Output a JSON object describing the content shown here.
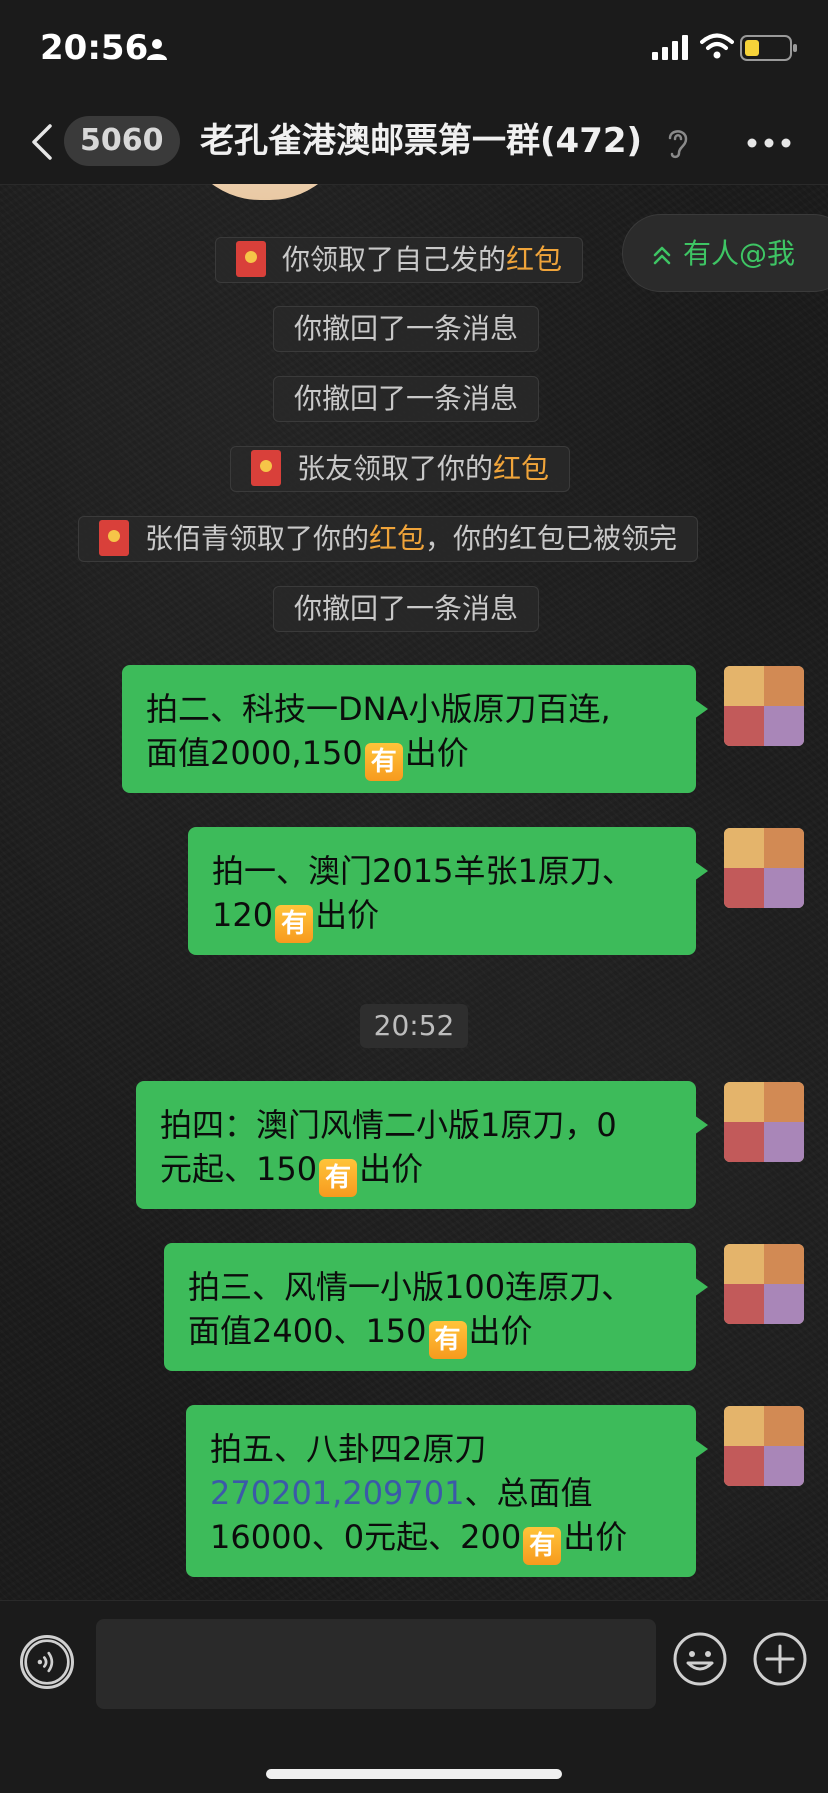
{
  "status_bar": {
    "time": "20:56"
  },
  "nav": {
    "unread_count": "5060",
    "title": "老孔雀港澳邮票第一群(472)"
  },
  "mention_pill": {
    "label": "有人@我"
  },
  "system_notices": [
    {
      "prefix": "你领取了自己发的",
      "highlight": "红包",
      "suffix": ""
    },
    {
      "prefix": "你撤回了一条消息",
      "highlight": "",
      "suffix": ""
    },
    {
      "prefix": "你撤回了一条消息",
      "highlight": "",
      "suffix": ""
    },
    {
      "prefix": "张友领取了你的",
      "highlight": "红包",
      "suffix": ""
    },
    {
      "prefix": "张佰青领取了你的",
      "highlight": "红包",
      "suffix": "，你的红包已被领完"
    },
    {
      "prefix": "你撤回了一条消息",
      "highlight": "",
      "suffix": ""
    }
  ],
  "time_separator": "20:52",
  "messages": [
    {
      "line1": "拍二、科技一DNA小版原刀百连,",
      "line2_pre": "面值2000,150",
      "badge": "有",
      "line2_post": "出价"
    },
    {
      "line1": "拍一、澳门2015羊张1原刀、",
      "line2_pre": "120",
      "badge": "有",
      "line2_post": "出价"
    },
    {
      "line1": "拍四：澳门风情二小版1原刀，0",
      "line2_pre": "元起、150",
      "badge": "有",
      "line2_post": "出价"
    },
    {
      "line1": "拍三、风情一小版100连原刀、",
      "line2_pre": "面值2400、150",
      "badge": "有",
      "line2_post": "出价"
    },
    {
      "line1": "拍五、八卦四2原刀",
      "link": "270201,209701",
      "line2_post_link": "、总面值",
      "line3_pre": "16000、0元起、200",
      "badge": "有",
      "line3_post": "出价"
    }
  ],
  "input": {
    "value": "",
    "placeholder": ""
  },
  "colors": {
    "accent_green": "#3dbb5a",
    "highlight_orange": "#f0a43a",
    "mention_green": "#3ec564"
  }
}
